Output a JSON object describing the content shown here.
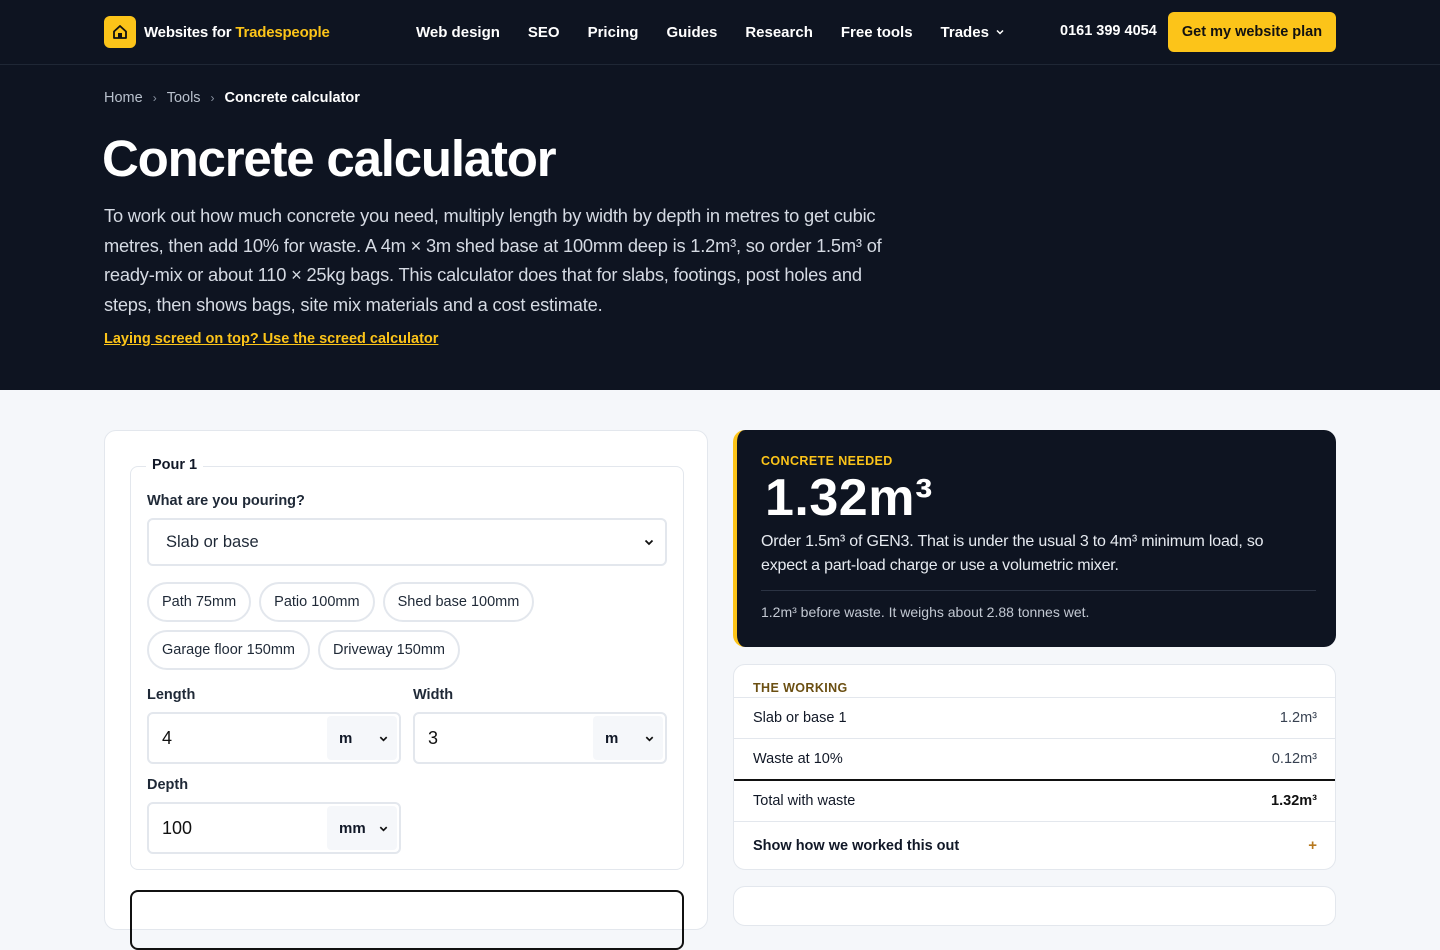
{
  "header": {
    "logo_part1": "Websites for ",
    "logo_part2": "Tradespeople",
    "nav": [
      "Web design",
      "SEO",
      "Pricing",
      "Guides",
      "Research",
      "Free tools",
      "Trades"
    ],
    "phone": "0161 399 4054",
    "cta": "Get my website plan"
  },
  "breadcrumb": {
    "home": "Home",
    "tools": "Tools",
    "current": "Concrete calculator"
  },
  "hero": {
    "title": "Concrete calculator",
    "intro": "To work out how much concrete you need, multiply length by width by depth in metres to get cubic metres, then add 10% for waste. A 4m × 3m shed base at 100mm deep is 1.2m³, so order 1.5m³ of ready-mix or about 110 × 25kg bags. This calculator does that for slabs, footings, post holes and steps, then shows bags, site mix materials and a cost estimate.",
    "screed_link": "Laying screed on top? Use the screed calculator"
  },
  "form": {
    "pour_legend": "Pour 1",
    "pouring_label": "What are you pouring?",
    "pouring_value": "Slab or base",
    "presets": [
      "Path 75mm",
      "Patio 100mm",
      "Shed base 100mm",
      "Garage floor 150mm",
      "Driveway 150mm"
    ],
    "length_label": "Length",
    "length_value": "4",
    "length_unit": "m",
    "width_label": "Width",
    "width_value": "3",
    "width_unit": "m",
    "depth_label": "Depth",
    "depth_value": "100",
    "depth_unit": "mm"
  },
  "result": {
    "kicker": "CONCRETE NEEDED",
    "value": "1.32m³",
    "order_text": "Order 1.5m³ of GEN3. That is under the usual 3 to 4m³ minimum load, so expect a part-load charge or use a volumetric mixer.",
    "note": "1.2m³ before waste. It weighs about 2.88 tonnes wet."
  },
  "working": {
    "kicker": "THE WORKING",
    "rows": [
      {
        "label": "Slab or base 1",
        "value": "1.2m³"
      },
      {
        "label": "Waste at 10%",
        "value": "0.12m³"
      },
      {
        "label": "Total with waste",
        "value": "1.32m³"
      }
    ],
    "show_label": "Show how we worked this out",
    "show_icon": "+"
  },
  "colors": {
    "navy": "#0e1421",
    "accent": "#fcc419"
  },
  "icons": [
    "house-icon",
    "chevron-down-icon",
    "chevron-right-icon",
    "plus-icon"
  ]
}
